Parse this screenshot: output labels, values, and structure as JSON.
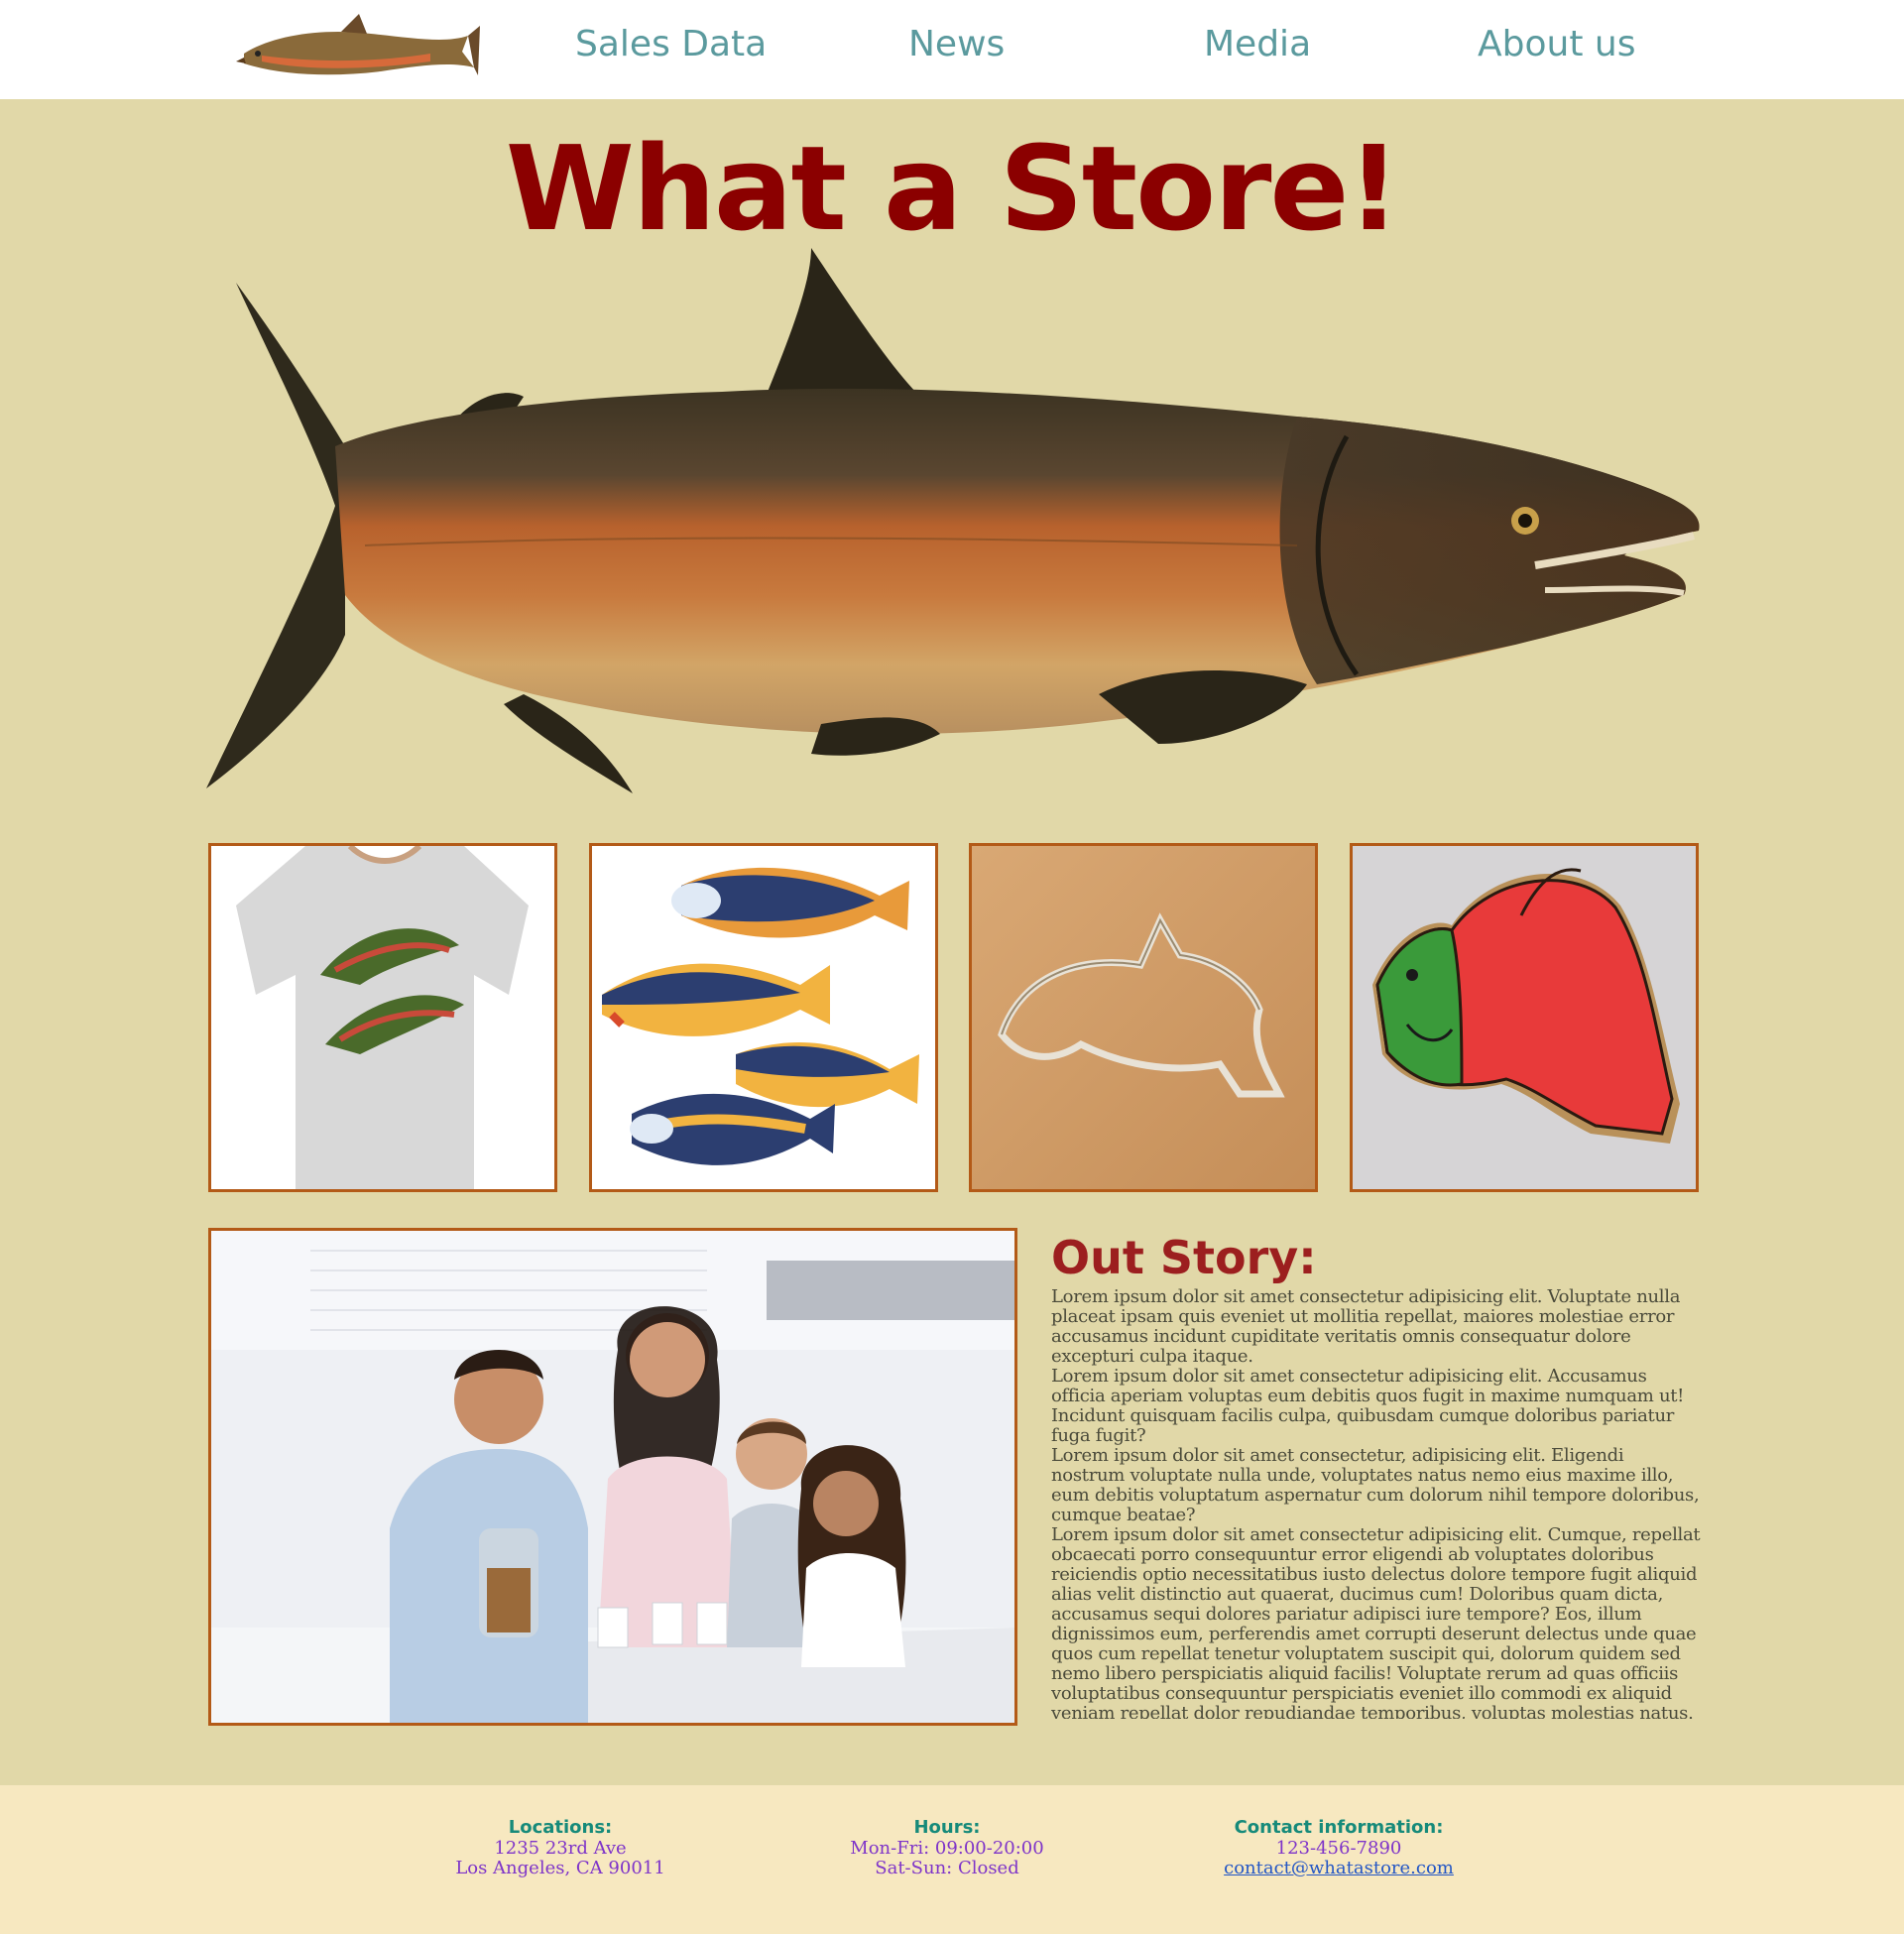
{
  "nav": {
    "items": [
      {
        "label": "Sales Data"
      },
      {
        "label": "News"
      },
      {
        "label": "Media"
      },
      {
        "label": "About us"
      }
    ]
  },
  "hero": {
    "title": "What a Store!"
  },
  "story": {
    "heading": "Out Story:",
    "paragraphs": [
      "Lorem ipsum dolor sit amet consectetur adipisicing elit. Voluptate nulla placeat ipsam quis eveniet ut mollitia repellat, maiores molestiae error accusamus incidunt cupiditate veritatis omnis consequatur dolore excepturi culpa itaque.",
      "Lorem ipsum dolor sit amet consectetur adipisicing elit. Accusamus officia aperiam voluptas eum debitis quos fugit in maxime numquam ut! Incidunt quisquam facilis culpa, quibusdam cumque doloribus pariatur fuga fugit?",
      "Lorem ipsum dolor sit amet consectetur, adipisicing elit. Eligendi nostrum voluptate nulla unde, voluptates natus nemo eius maxime illo, eum debitis voluptatum aspernatur cum dolorum nihil tempore doloribus, cumque beatae?",
      "Lorem ipsum dolor sit amet consectetur adipisicing elit. Cumque, repellat obcaecati porro consequuntur error eligendi ab voluptates doloribus reiciendis optio necessitatibus iusto delectus dolore tempore fugit aliquid alias velit distinctio aut quaerat, ducimus cum! Doloribus quam dicta, accusamus sequi dolores pariatur adipisci iure tempore? Eos, illum dignissimos eum, perferendis amet corrupti deserunt delectus unde quae quos cum repellat tenetur voluptatem suscipit qui, dolorum quidem sed nemo libero perspiciatis aliquid facilis! Voluptate rerum ad quas officiis voluptatibus consequuntur perspiciatis eveniet illo commodi ex aliquid veniam repellat dolor repudiandae temporibus, voluptas molestias natus."
    ]
  },
  "footer": {
    "locations": {
      "heading": "Locations:",
      "line1": "1235 23rd Ave",
      "line2": "Los Angeles, CA 90011"
    },
    "hours": {
      "heading": "Hours:",
      "line1": "Mon-Fri: 09:00-20:00",
      "line2": "Sat-Sun: Closed"
    },
    "contact": {
      "heading": "Contact information:",
      "phone": "123-456-7890",
      "email": "contact@whatastore.com"
    }
  },
  "colors": {
    "page_bg": "#e1d8a8",
    "nav_bg": "#ffffff",
    "nav_link": "#5b9a9e",
    "title": "#8b0000",
    "story_heading": "#9c1f1f",
    "thumb_border": "#b35a17",
    "footer_bg": "#f7e8c0",
    "footer_heading": "#168a7a",
    "footer_text": "#7e34c9",
    "footer_link": "#2356c5"
  },
  "images": {
    "logo": "salmon-logo",
    "hero": "salmon-illustration",
    "thumbnails": [
      "salmon-tshirt",
      "painted-fish-cookies",
      "fish-cookie-cutter",
      "red-salmon-cookie"
    ],
    "family": "family-kitchen-photo"
  }
}
